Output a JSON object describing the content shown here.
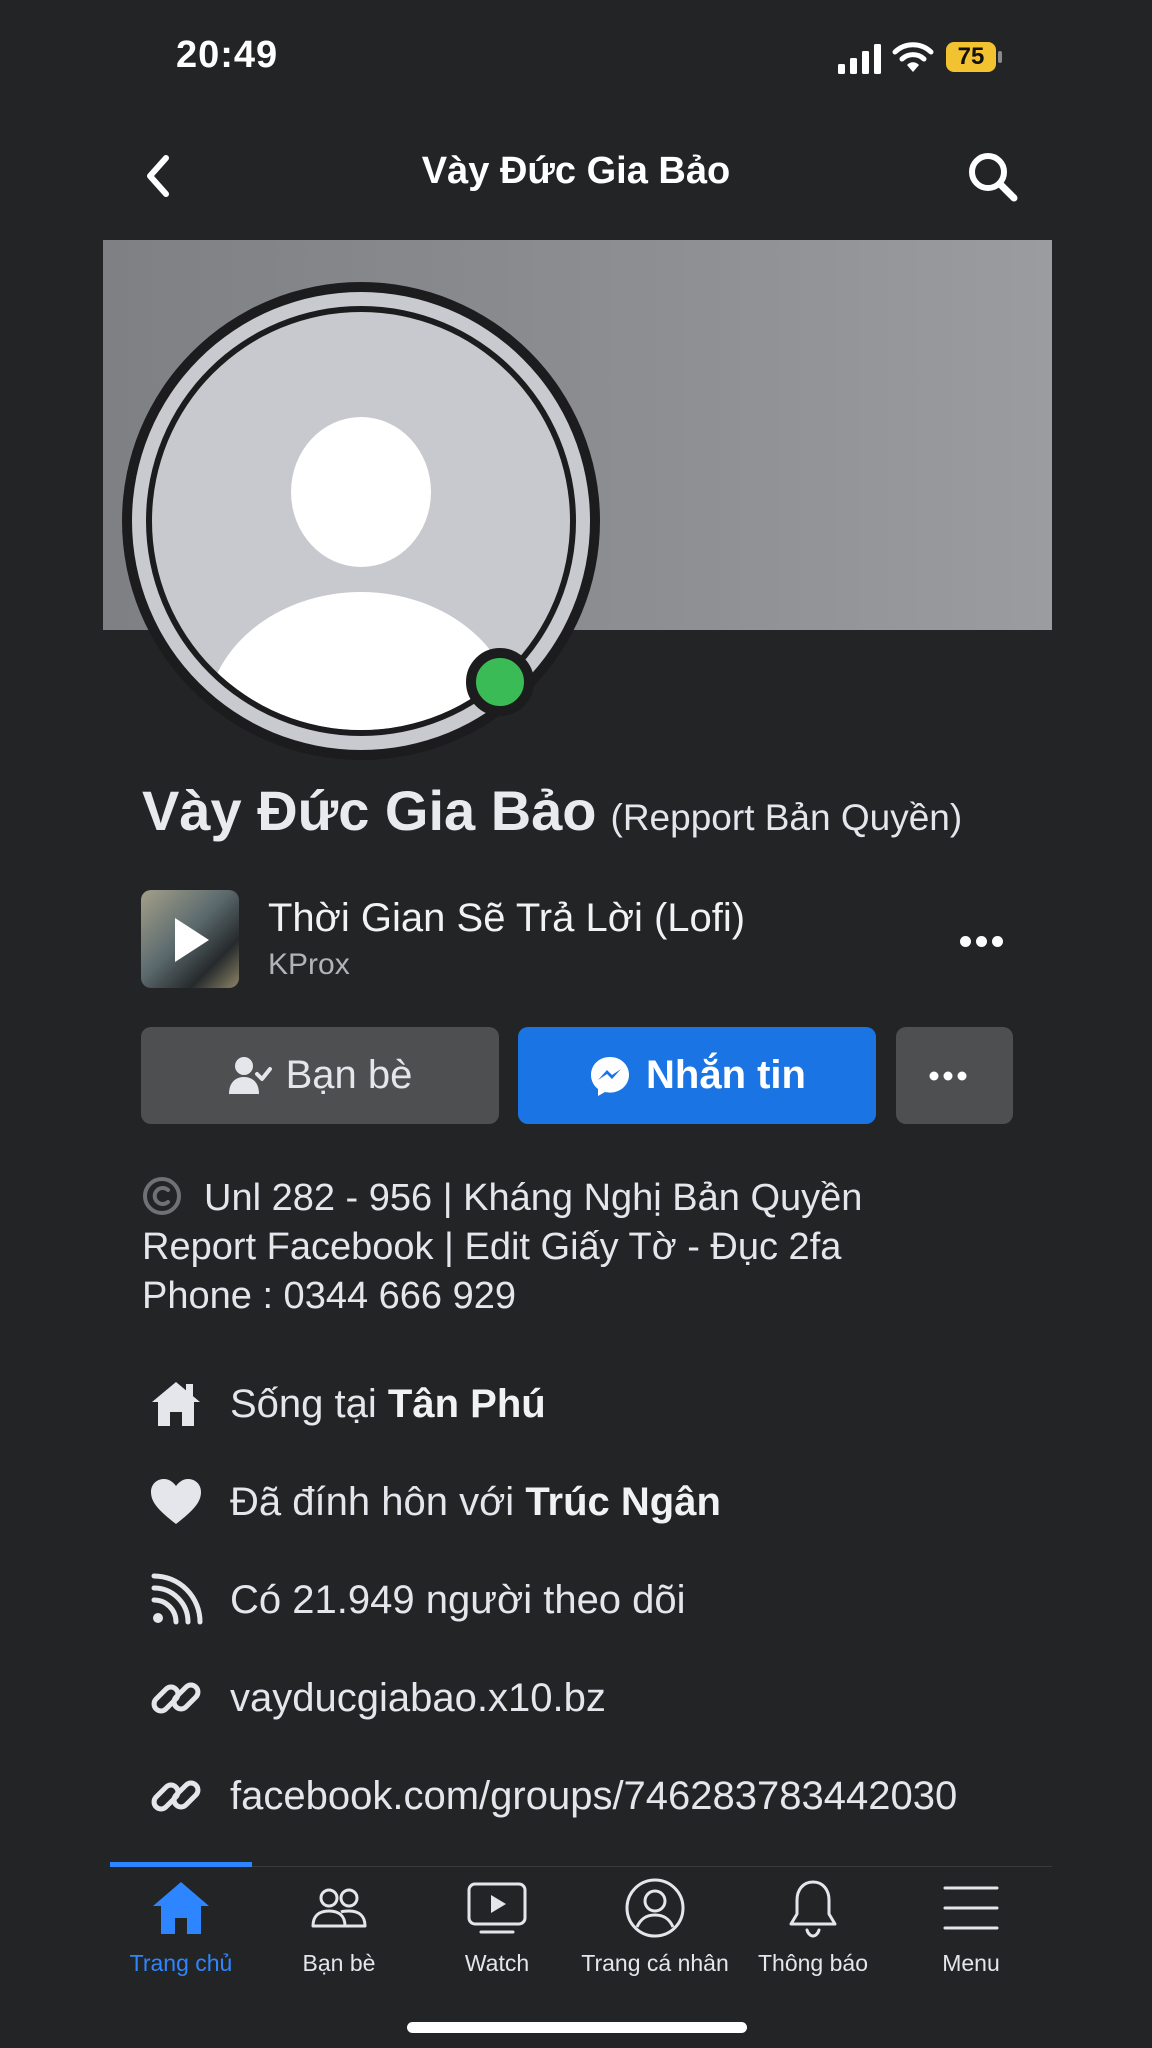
{
  "status_bar": {
    "time": "20:49",
    "battery": "75"
  },
  "header": {
    "title": "Vày Đức Gia Bảo"
  },
  "profile": {
    "name": "Vày Đức Gia Bảo",
    "name_suffix": "(Repport Bản Quyền)",
    "online": true
  },
  "music": {
    "title": "Thời Gian Sẽ Trả Lời (Lofi)",
    "artist": "KProx"
  },
  "actions": {
    "friends_label": "Bạn bè",
    "message_label": "Nhắn tin"
  },
  "bio": {
    "line1": "Unl 282 - 956 | Kháng Nghị Bản Quyền",
    "line2": "Report Facebook | Edit Giấy Tờ - Đục 2fa",
    "line3": "Phone : 0344 666 929"
  },
  "details": {
    "lives_prefix": "Sống tại ",
    "lives_place": "Tân Phú",
    "relationship_prefix": "Đã đính hôn với ",
    "relationship_name": "Trúc Ngân",
    "followers": "Có 21.949 người theo dõi",
    "website": "vayducgiabao.x10.bz",
    "group_link": "facebook.com/groups/746283783442030"
  },
  "bottom_nav": {
    "home": "Trang chủ",
    "friends": "Bạn bè",
    "watch": "Watch",
    "profile": "Trang cá nhân",
    "notifications": "Thông báo",
    "menu": "Menu"
  },
  "colors": {
    "accent": "#1a74e4",
    "nav_active": "#2d86ff",
    "online": "#3abb56",
    "background": "#232426"
  }
}
